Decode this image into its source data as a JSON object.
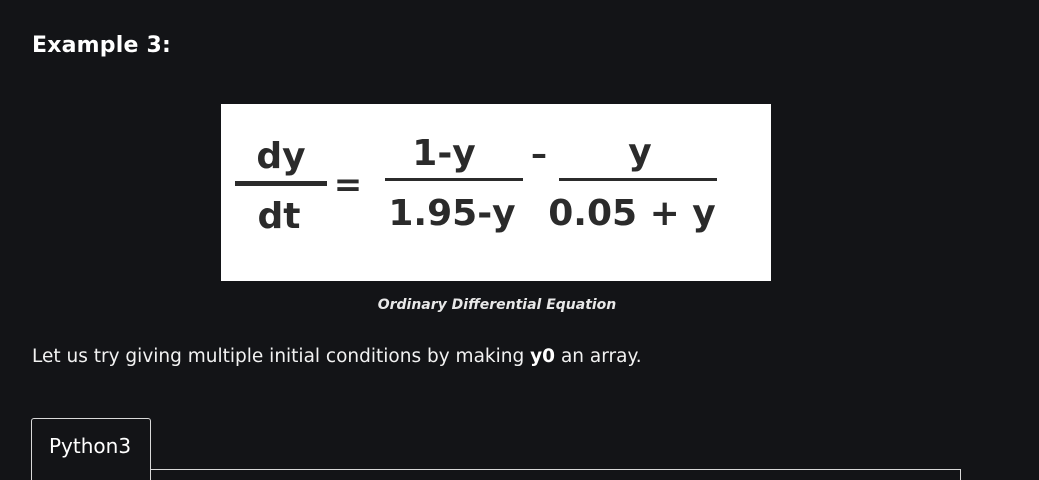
{
  "heading": "Example 3:",
  "equation": {
    "lhs_numerator": "dy",
    "lhs_denominator": "dt",
    "equals": "=",
    "term1_numerator": "1-y",
    "term1_denominator": "1.95-y",
    "minus": "–",
    "term2_numerator": "y",
    "term2_denominator": "0.05 + y"
  },
  "caption": "Ordinary Differential Equation",
  "paragraph": {
    "before": "Let us try giving multiple initial conditions by making ",
    "code": "y0",
    "after": " an array."
  },
  "code_tabs": [
    {
      "label": "Python3",
      "active": true
    }
  ],
  "colors": {
    "page_background": "#131417",
    "equation_background": "#ffffff",
    "equation_text": "#2b2b2b",
    "tab_border": "#d9d9d9"
  }
}
